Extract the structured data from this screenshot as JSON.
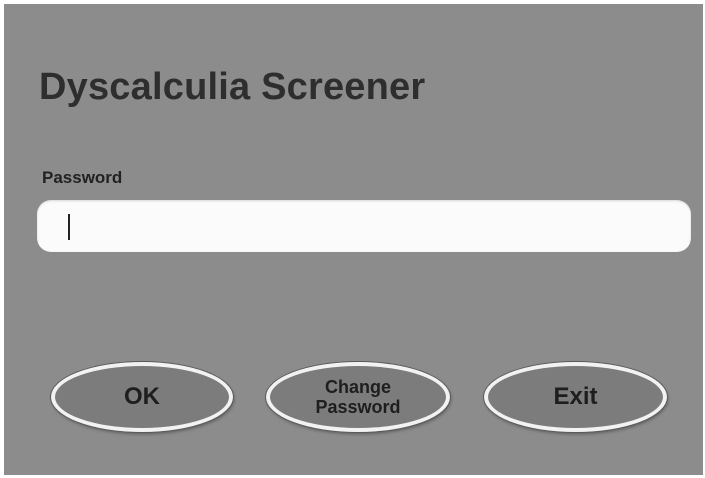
{
  "app": {
    "title": "Dyscalculia Screener"
  },
  "form": {
    "password_label": "Password",
    "password_value": ""
  },
  "buttons": {
    "ok_label": "OK",
    "change_label_line1": "Change",
    "change_label_line2": "Password",
    "exit_label": "Exit"
  },
  "colors": {
    "background": "#8c8c8c",
    "input_background": "#fbfbfb",
    "button_fill": "#7c7c7c",
    "button_border": "#f2f2f2",
    "text": "#2e2e2e"
  }
}
